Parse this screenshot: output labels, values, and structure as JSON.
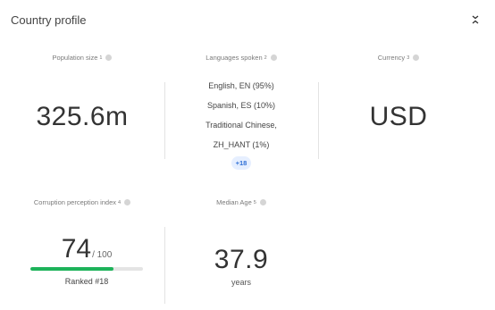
{
  "header": {
    "title": "Country profile"
  },
  "population": {
    "label": "Population size",
    "ref": "1",
    "value": "325.6m"
  },
  "languages": {
    "label": "Languages spoken",
    "ref": "2",
    "items": [
      "English, EN (95%)",
      "Spanish, ES (10%)",
      "Traditional Chinese,",
      "ZH_HANT (1%)"
    ],
    "more": "+18"
  },
  "currency": {
    "label": "Currency",
    "ref": "3",
    "value": "USD"
  },
  "corruption": {
    "label": "Corruption perception index",
    "ref": "4",
    "score": "74",
    "max": "/ 100",
    "fill_fraction": 0.74,
    "ranked": "Ranked #18",
    "bar_color": "#1db35a"
  },
  "median_age": {
    "label": "Median Age",
    "ref": "5",
    "value": "37.9",
    "unit": "years"
  },
  "icons": {
    "info": "info-icon",
    "collapse": "chevron-collapse-icon"
  }
}
